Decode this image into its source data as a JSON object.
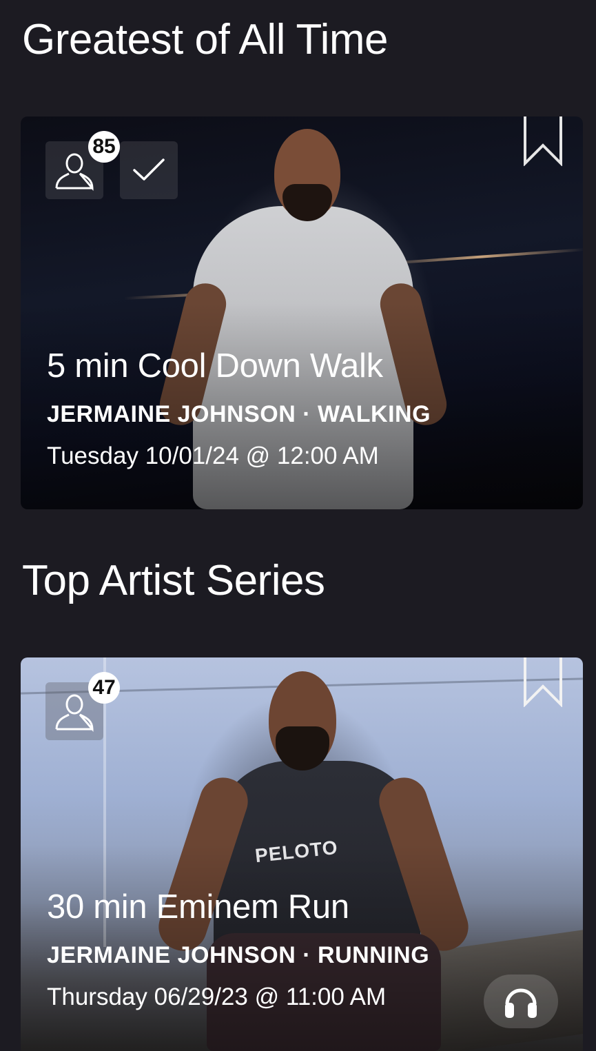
{
  "sections": [
    {
      "title": "Greatest of All Time",
      "card": {
        "friends_count": "85",
        "completed": true,
        "title": "5 min Cool Down Walk",
        "instructor": "JERMAINE JOHNSON",
        "separator": "·",
        "discipline": "WALKING",
        "date": "Tuesday 10/01/24 @ 12:00 AM"
      }
    },
    {
      "title": "Top Artist Series",
      "card": {
        "friends_count": "47",
        "completed": false,
        "title": "30 min Eminem Run",
        "instructor": "JERMAINE JOHNSON",
        "separator": "·",
        "discipline": "RUNNING",
        "date": "Thursday 06/29/23 @ 11:00 AM",
        "shirt_text": "PELOTO"
      }
    }
  ],
  "icons": {
    "friends": "person-outline-icon",
    "check": "checkmark-icon",
    "bookmark": "bookmark-icon",
    "headphones": "headphones-icon"
  },
  "colors": {
    "background": "#1c1b22",
    "text": "#ffffff",
    "badge_bg": "#ffffff",
    "badge_text": "#111111"
  }
}
